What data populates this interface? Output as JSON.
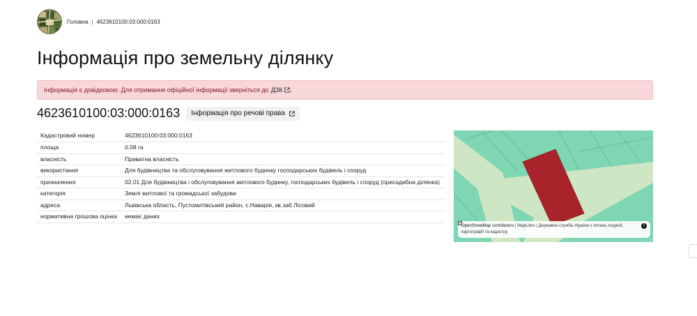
{
  "breadcrumb": {
    "home": "Головна",
    "separator": "|",
    "current": "4623610100:03:000:0163"
  },
  "page_title": "Інформація про земельну ділянку",
  "alert": {
    "text": "Інформація є довідковою. Для отримання офіційної інформації зверніться до",
    "link_label": "ДЗК",
    "end": "."
  },
  "cadastral_number": "4623610100:03:000:0163",
  "rights_button_label": "Інформація про речові права",
  "info_rows": [
    {
      "key": "Кадастровий номер",
      "value": "4623610100:03:000:0163"
    },
    {
      "key": "площа",
      "value": "0.08 га"
    },
    {
      "key": "власність",
      "value": "Приватна власність"
    },
    {
      "key": "використання",
      "value": "Для будівництва та обслуговування житлового будинку господарських будівель і споруд"
    },
    {
      "key": "призначення",
      "value": "02.01 Для будівництва і обслуговування житлового будинку, господарських будівель і споруд (присадибна ділянка)"
    },
    {
      "key": "категорія",
      "value": "Землі житлової та громадської забудови"
    },
    {
      "key": "адреса",
      "value": "Львівська область, Пустомитівський район, с.Наварія, кв.заб Лісовий"
    },
    {
      "key": "нормативна грошова оцінка",
      "value": "немає даних"
    }
  ],
  "map": {
    "attribution": {
      "osm": "OpenStreetMap contributors",
      "sep1": "|",
      "maplibre": "MapLibre",
      "sep2": "|",
      "agency": "Державна служба України з питань геодезії, картографії та кадастру"
    },
    "info_glyph": "i",
    "colors": {
      "land": "#7ed6b3",
      "road": "#cfe6c4",
      "parcel": "#a8242a"
    }
  }
}
